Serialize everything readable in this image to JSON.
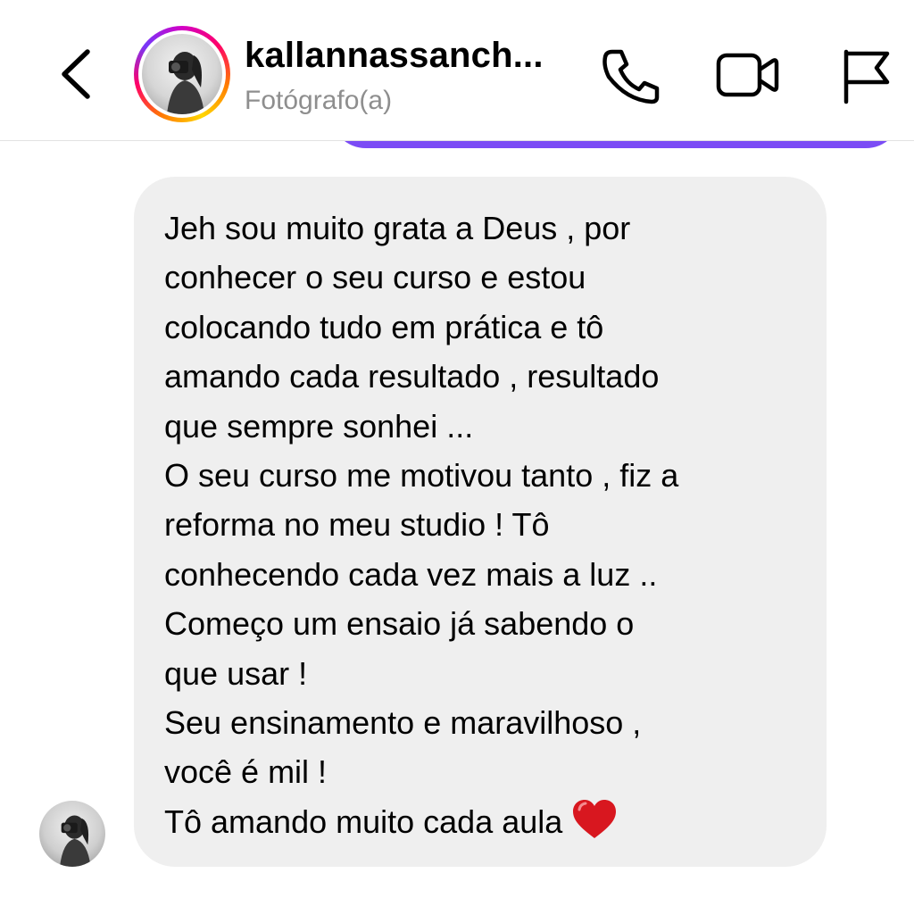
{
  "header": {
    "username": "kallannassanch...",
    "subtitle": "Fotógrafo(a)",
    "icons": {
      "back": "chevron-left-icon",
      "call": "phone-icon",
      "video": "video-camera-icon",
      "report": "flag-icon"
    }
  },
  "message": {
    "lines": [
      "Jeh sou muito grata a Deus , por",
      "conhecer o seu curso e estou",
      "colocando tudo em prática e tô",
      "amando cada resultado , resultado",
      "que sempre sonhei ...",
      "O seu curso me motivou tanto , fiz a",
      "reforma no meu studio ! Tô",
      "conhecendo cada vez mais a luz ..",
      "Começo um ensaio já sabendo o",
      "que usar !",
      "Seu ensinamento e maravilhoso ,",
      "você é mil !",
      "Tô amando muito cada aula"
    ],
    "emoji": "heart-emoji"
  },
  "colors": {
    "bubble": "#efefef",
    "sent_bubble": "#7b4cf5",
    "subtitle": "#8e8e8e",
    "heart": "#d8171f"
  }
}
